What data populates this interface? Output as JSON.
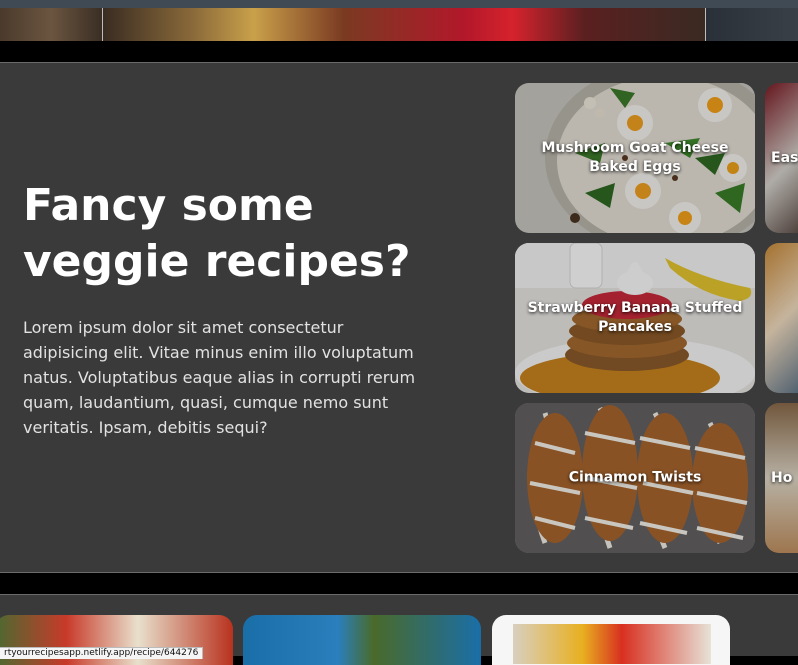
{
  "hero": {
    "title": "Fancy some veggie recipes?",
    "text": "Lorem ipsum dolor sit amet consectetur adipisicing elit. Vitae minus enim illo voluptatum natus. Voluptatibus eaque alias in corrupti rerum quam, laudantium, quasi, cumque nemo sunt veritatis. Ipsam, debitis sequi?"
  },
  "recipes": [
    {
      "title": "Mushroom Goat Cheese Baked Eggs",
      "icon": "baked-eggs-photo"
    },
    {
      "title": "Strawberry Banana Stuffed Pancakes",
      "icon": "pancakes-photo"
    },
    {
      "title": "Cinnamon Twists",
      "icon": "cinnamon-twists-photo"
    }
  ],
  "peek_recipes": [
    {
      "title": "Eas"
    },
    {
      "title": ""
    },
    {
      "title": "Ho"
    }
  ],
  "status_bar": {
    "url": "rtyourrecipesapp.netlify.app/recipe/644276"
  }
}
